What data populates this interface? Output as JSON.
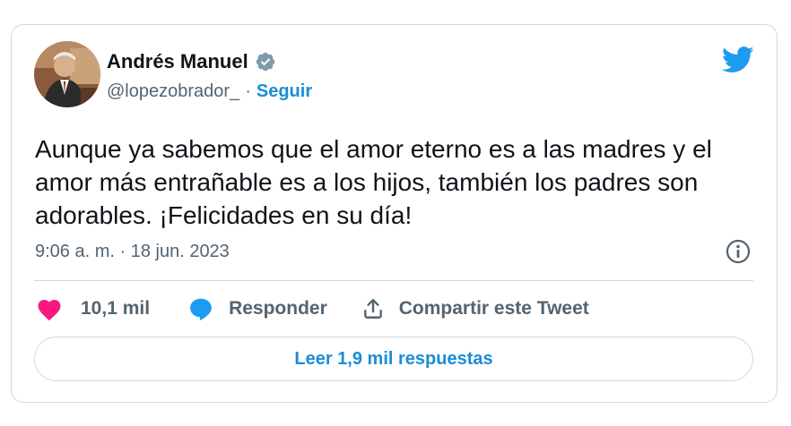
{
  "user": {
    "display_name": "Andrés Manuel",
    "handle": "@lopezobrador_",
    "separator": "·",
    "follow_label": "Seguir"
  },
  "tweet": {
    "text": "Aunque ya sabemos que el amor eterno es a las madres y el amor más entrañable es a los hijos, también los padres son adorables. ¡Felicidades en su día!",
    "timestamp": "9:06 a. m. · 18 jun. 2023"
  },
  "actions": {
    "like_count": "10,1 mil",
    "reply_label": "Responder",
    "share_label": "Compartir este Tweet"
  },
  "read_replies_label": "Leer 1,9 mil respuestas",
  "colors": {
    "like": "#f91880",
    "accent": "#1d9bf0",
    "muted": "#536471",
    "border": "#cfd9de"
  },
  "icons": [
    "verified-badge-icon",
    "twitter-bird-icon",
    "info-icon",
    "heart-icon",
    "reply-bubble-icon",
    "share-icon"
  ]
}
